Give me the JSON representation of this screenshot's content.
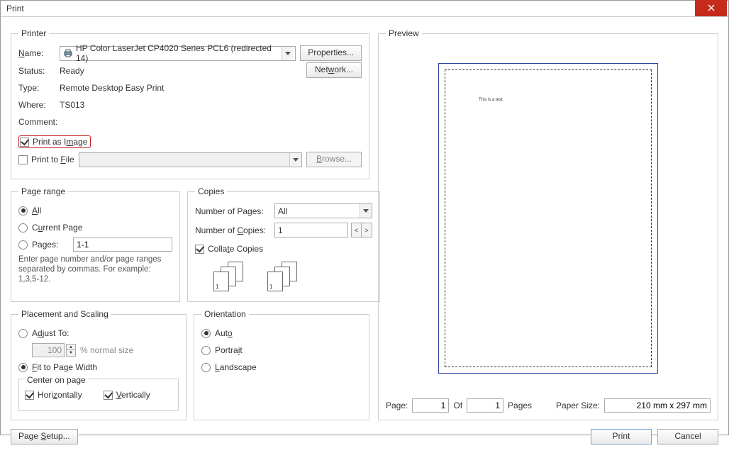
{
  "window": {
    "title": "Print"
  },
  "printer": {
    "group": "Printer",
    "name_label": "Name:",
    "selected": "HP Color LaserJet CP4020 Series PCL6 (redirected 14)",
    "properties_btn": "Properties...",
    "network_btn": "Network...",
    "status_label": "Status:",
    "status_value": "Ready",
    "type_label": "Type:",
    "type_value": "Remote Desktop Easy Print",
    "where_label": "Where:",
    "where_value": "TS013",
    "comment_label": "Comment:",
    "print_as_image": "Print as Image",
    "print_to_file": "Print to File",
    "browse_btn": "Browse..."
  },
  "page_range": {
    "group": "Page range",
    "all": "All",
    "current": "Current Page",
    "pages_label": "Pages:",
    "pages_value": "1-1",
    "hint": "Enter page number and/or page ranges separated by commas. For example: 1,3,5-12."
  },
  "copies": {
    "group": "Copies",
    "pages_label": "Number of Pages:",
    "pages_value": "All",
    "copies_label": "Number of Copies:",
    "copies_value": "1",
    "collate": "Collate Copies"
  },
  "placement": {
    "group": "Placement and Scaling",
    "adjust": "Adjust To:",
    "adjust_value": "100",
    "adjust_suffix": "% normal size",
    "fit": "Fit to Page Width",
    "center_group": "Center on page",
    "horiz": "Horizontally",
    "vert": "Vertically"
  },
  "orientation": {
    "group": "Orientation",
    "auto": "Auto",
    "portrait": "Portrait",
    "landscape": "Landscape"
  },
  "preview": {
    "group": "Preview",
    "sample_text": "This is a test",
    "page_label": "Page:",
    "page_value": "1",
    "of_label": "Of",
    "total_value": "1",
    "pages_suffix": "Pages",
    "paper_size_label": "Paper Size:",
    "paper_size_value": "210 mm x 297 mm"
  },
  "footer": {
    "page_setup": "Page Setup...",
    "print": "Print",
    "cancel": "Cancel"
  }
}
